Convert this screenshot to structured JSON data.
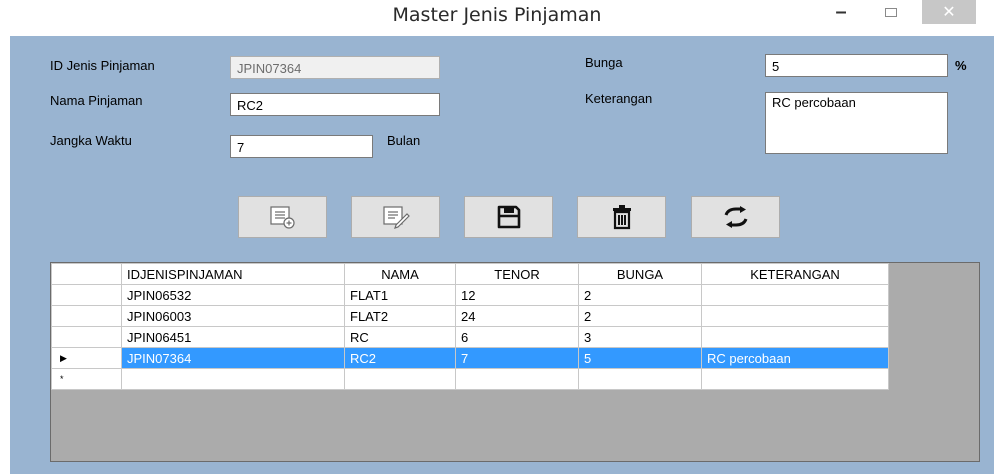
{
  "window": {
    "title": "Master Jenis Pinjaman",
    "min_glyph": "–",
    "close_glyph": "✕"
  },
  "form": {
    "id_label": "ID Jenis Pinjaman",
    "id_value": "JPIN07364",
    "nama_label": "Nama Pinjaman",
    "nama_value": "RC2",
    "jangka_label": "Jangka Waktu",
    "jangka_value": "7",
    "bulan_label": "Bulan",
    "bunga_label": "Bunga",
    "bunga_value": "5",
    "percent_label": "%",
    "ket_label": "Keterangan",
    "ket_value": "RC percobaan"
  },
  "toolbar": {
    "icons": [
      "add-record-icon",
      "edit-record-icon",
      "save-icon",
      "delete-icon",
      "refresh-icon"
    ]
  },
  "grid": {
    "columns": [
      "IDJENISPINJAMAN",
      "NAMA",
      "TENOR",
      "BUNGA",
      "KETERANGAN"
    ],
    "rows": [
      [
        "JPIN06532",
        "FLAT1",
        "12",
        "2",
        ""
      ],
      [
        "JPIN06003",
        "FLAT2",
        "24",
        "2",
        ""
      ],
      [
        "JPIN06451",
        "RC",
        "6",
        "3",
        ""
      ],
      [
        "JPIN07364",
        "RC2",
        "7",
        "5",
        "RC percobaan"
      ]
    ],
    "selected_row": 3,
    "current_marker": "▶",
    "new_row_marker": "*"
  },
  "colors": {
    "client_bg": "#99b4d1",
    "selection": "#3399ff"
  }
}
